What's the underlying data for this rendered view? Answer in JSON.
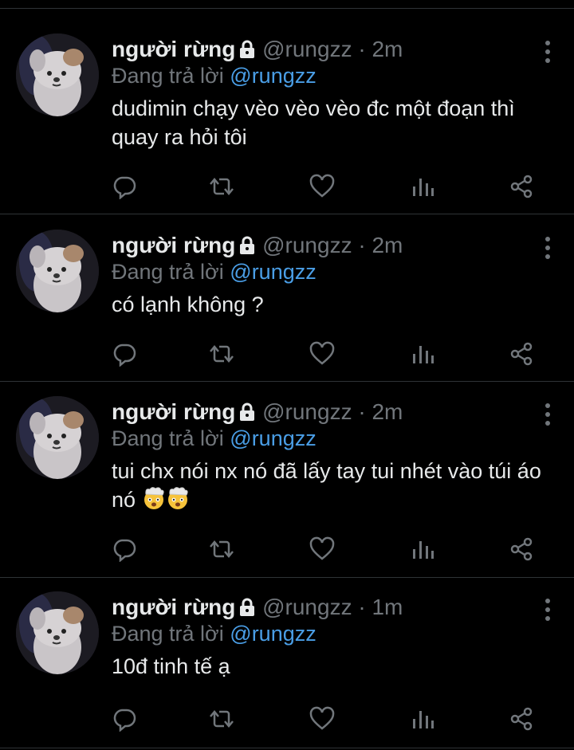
{
  "tweets": [
    {
      "name": "người rừng",
      "handle": "@rungzz",
      "separator": "·",
      "time": "2m",
      "replying_prefix": "Đang trả lời",
      "replying_to": "@rungzz",
      "text": "dudimin chạy vèo vèo vèo đc một đoạn thì quay ra hỏi tôi",
      "emojis": []
    },
    {
      "name": "người rừng",
      "handle": "@rungzz",
      "separator": "·",
      "time": "2m",
      "replying_prefix": "Đang trả lời",
      "replying_to": "@rungzz",
      "text": "có lạnh không ?",
      "emojis": []
    },
    {
      "name": "người rừng",
      "handle": "@rungzz",
      "separator": "·",
      "time": "2m",
      "replying_prefix": "Đang trả lời",
      "replying_to": "@rungzz",
      "text": "tui chx nói nx nó đã lấy tay tui nhét vào túi áo nó",
      "emojis": [
        "exploding-head-emoji",
        "exploding-head-emoji"
      ]
    },
    {
      "name": "người rừng",
      "handle": "@rungzz",
      "separator": "·",
      "time": "1m",
      "replying_prefix": "Đang trả lời",
      "replying_to": "@rungzz",
      "text": "10đ tinh tế ạ",
      "emojis": []
    }
  ],
  "icons": {
    "lock": "lock-icon",
    "more": "more-options-icon",
    "reply": "reply-icon",
    "retweet": "retweet-icon",
    "like": "like-icon",
    "views": "views-icon",
    "share": "share-icon"
  },
  "colors": {
    "background": "#000000",
    "text": "#e7e9ea",
    "muted": "#71767b",
    "mention": "#4a9ee6",
    "divider": "#2f3336"
  }
}
